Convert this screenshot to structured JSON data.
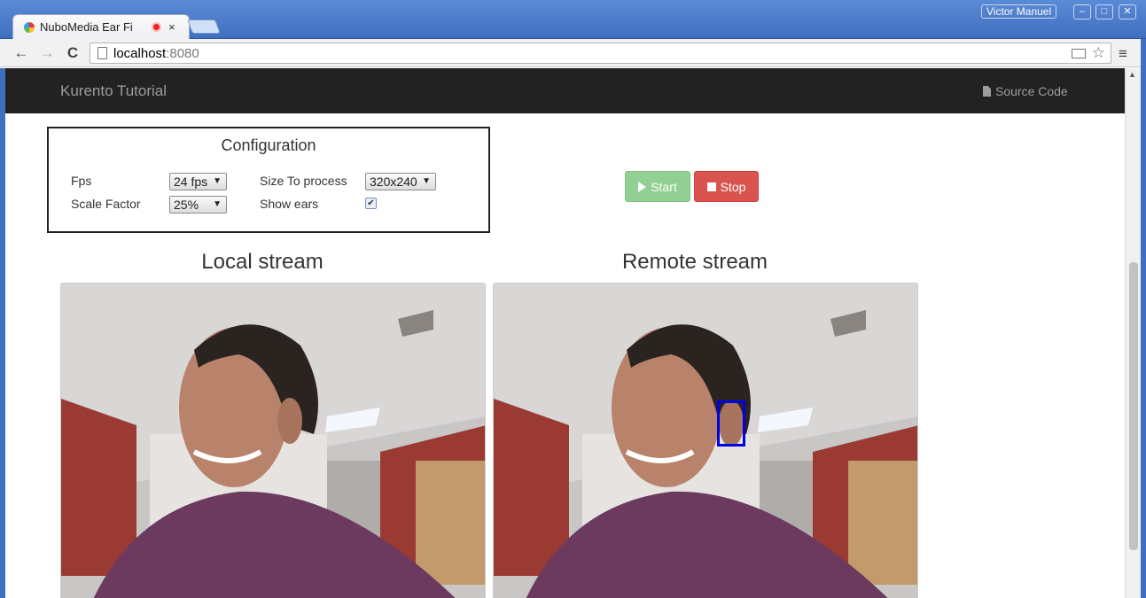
{
  "browser": {
    "tab_title": "NuboMedia Ear Fi",
    "tab_close": "×",
    "user": "Victor Manuel",
    "window_buttons": {
      "minimize": "–",
      "maximize": "□",
      "close": "✕"
    },
    "nav": {
      "back": "←",
      "forward": "→",
      "reload": "C"
    },
    "url_host": "localhost",
    "url_port": ":8080",
    "menu": "≡",
    "star": "☆"
  },
  "navbar": {
    "brand": "Kurento Tutorial",
    "source_code": "Source Code"
  },
  "config": {
    "title": "Configuration",
    "fps_label": "Fps",
    "fps_value": "24 fps",
    "scale_label": "Scale Factor",
    "scale_value": "25%",
    "size_label": "Size To process",
    "size_value": "320x240",
    "show_ears_label": "Show ears",
    "show_ears_checked": true,
    "check_mark": "✔",
    "caret": "▼"
  },
  "controls": {
    "start_label": "Start",
    "stop_label": "Stop"
  },
  "streams": {
    "local_title": "Local stream",
    "remote_title": "Remote stream"
  },
  "colors": {
    "navbar_bg": "#222222",
    "start_bg": "#92cf92",
    "stop_bg": "#d9534f",
    "ear_box": "#0000e6"
  }
}
